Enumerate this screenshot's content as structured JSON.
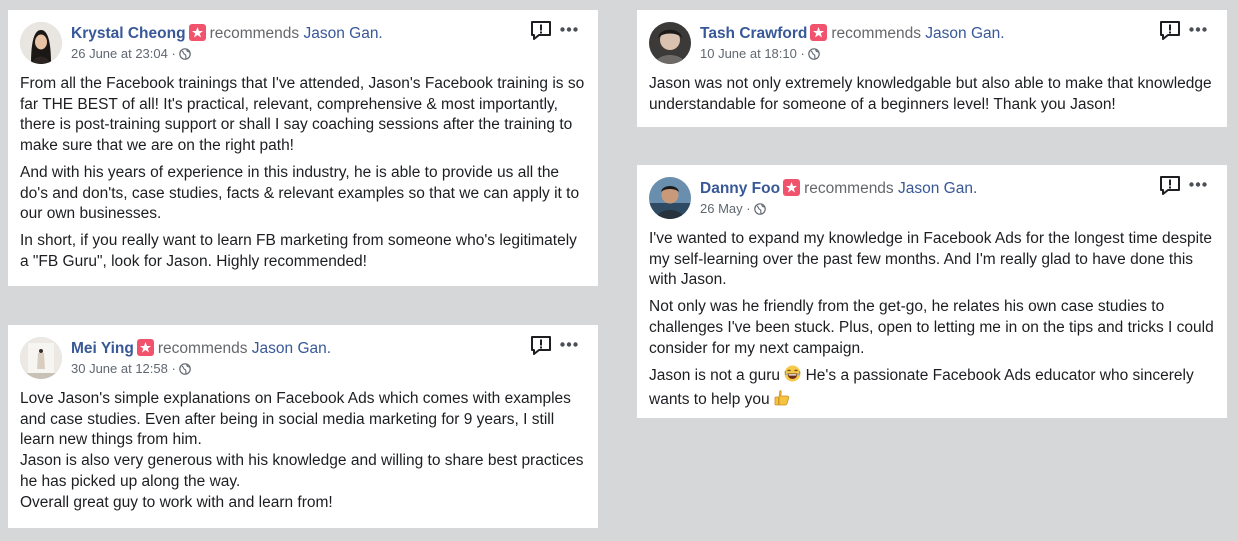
{
  "common": {
    "recommends": "recommends",
    "target": "Jason Gan."
  },
  "reviews": [
    {
      "name": "Krystal Cheong",
      "date": "26 June at 23:04 ·",
      "paragraphs": [
        "From all the Facebook trainings that I've attended, Jason's Facebook training is so far THE BEST of all! It's practical, relevant, comprehensive & most importantly, there is post-training support or shall I say coaching sessions after the training to make sure that we are on the right path!",
        "And with his years of experience in this industry, he is able to provide us all the do's and don'ts, case studies, facts & relevant examples so that we can apply it to our own businesses.",
        "In short, if you really want to learn FB marketing from someone who's legitimately a \"FB Guru\", look for Jason. Highly recommended!"
      ]
    },
    {
      "name": "Mei Ying",
      "date": "30 June at 12:58 ·",
      "paragraphs": [
        "Love Jason's simple explanations on Facebook Ads which comes with examples and case studies. Even after being in social media marketing for 9 years, I still learn new things from him.",
        "Jason is also very generous with his knowledge and willing to share best practices he has picked up along the way.",
        "Overall great guy to work with and learn from!"
      ]
    },
    {
      "name": "Tash Crawford",
      "date": "10 June at 18:10 ·",
      "paragraphs": [
        "Jason was not only extremely knowledgable but also able to make that knowledge understandable for someone of a beginners level! Thank you Jason!"
      ]
    },
    {
      "name": "Danny Foo",
      "date": "26 May ·",
      "paragraphs": [
        "I've wanted to expand my knowledge in Facebook Ads for the longest time despite my self-learning over the past few months. And I'm really glad to have done this with Jason.",
        "Not only was he friendly from the get-go, he relates his own case studies to challenges I've been stuck. Plus, open to letting me in on the tips and tricks I could consider for my next campaign."
      ],
      "last_line_1": "Jason is not a guru",
      "last_line_2": "He's a passionate Facebook Ads educator who sincerely wants to help you"
    }
  ],
  "icons": {
    "badge": "recommend-star-icon",
    "privacy": "globe-icon",
    "report": "report-icon",
    "more": "more-dots-icon",
    "emoji1": "laughing-emoji-icon",
    "emoji2": "thumbs-up-emoji-icon"
  },
  "colors": {
    "name": "#385898",
    "badge": "#f0536b",
    "text": "#1c1e21",
    "meta": "#606770",
    "background": "#d6d7d9"
  }
}
